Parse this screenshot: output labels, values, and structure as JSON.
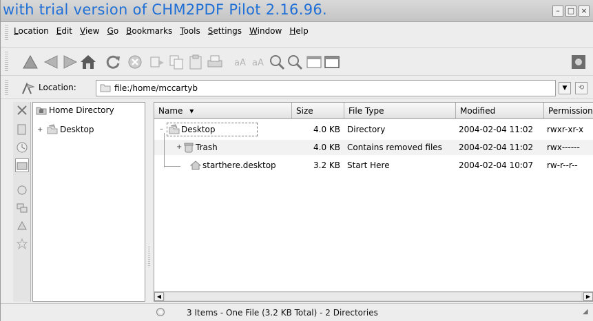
{
  "window": {
    "title": "with trial version of CHM2PDF Pilot 2.16.96.",
    "controls": {
      "minimize": "–",
      "maximize": "□",
      "close": "×"
    }
  },
  "menubar": {
    "items": [
      "Location",
      "Edit",
      "View",
      "Go",
      "Bookmarks",
      "Tools",
      "Settings",
      "Window",
      "Help"
    ]
  },
  "toolbar": {
    "icons": [
      "up-arrow-icon",
      "back-arrow-icon",
      "forward-arrow-icon",
      "home-icon",
      "reload-icon",
      "stop-icon",
      "cut-icon",
      "copy-icon",
      "paste-icon",
      "print-icon",
      "undo-icon",
      "redo-icon",
      "zoom-in-icon",
      "zoom-out-icon",
      "icon-view-icon",
      "detail-view-icon",
      "throbber-icon"
    ]
  },
  "locationbar": {
    "label": "Location:",
    "value": "file:/home/mccartyb"
  },
  "navtree": {
    "items": [
      {
        "label": "Home Directory",
        "icon": "home-folder-icon"
      },
      {
        "label": "Desktop",
        "icon": "desktop-folder-icon"
      }
    ]
  },
  "filelist": {
    "columns": [
      "Name",
      "Size",
      "File Type",
      "Modified",
      "Permissions"
    ],
    "sort_indicator": "▾",
    "rows": [
      {
        "expander": "–",
        "name": "Desktop",
        "size": "4.0 KB",
        "type": "Directory",
        "modified": "2004-02-04 11:02",
        "permissions": "rwxr-xr-x",
        "icon": "desktop-folder-icon",
        "depth": 0
      },
      {
        "expander": "+",
        "name": "Trash",
        "size": "4.0 KB",
        "type": "Contains removed files",
        "modified": "2004-02-04 11:02",
        "permissions": "rwx------",
        "icon": "trash-icon",
        "depth": 1
      },
      {
        "expander": "",
        "name": "starthere.desktop",
        "size": "3.2 KB",
        "type": "Start Here",
        "modified": "2004-02-04 10:07",
        "permissions": "rw-r--r--",
        "icon": "start-here-icon",
        "depth": 1
      }
    ]
  },
  "statusbar": {
    "text": "3 Items - One File (3.2 KB Total) - 2 Directories"
  },
  "colors": {
    "title_text": "#1f6fd6",
    "accent": "#3a7bd5"
  }
}
